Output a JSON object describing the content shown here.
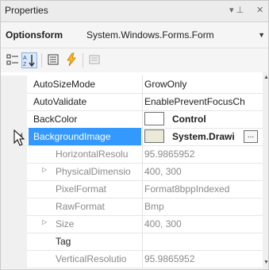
{
  "window": {
    "title": "Properties",
    "pin_glyph": "▾ ⊥",
    "close_glyph": "✕"
  },
  "object_selector": {
    "name": "Optionsform",
    "type": "System.Windows.Forms.Form"
  },
  "toolbar": {
    "buttons": [
      {
        "icon": "categorized-icon"
      },
      {
        "icon": "alphabetical-icon",
        "active": true
      },
      {
        "icon": "properties-icon"
      },
      {
        "icon": "events-icon"
      },
      {
        "icon": "property-pages-icon"
      }
    ]
  },
  "properties": [
    {
      "name": "AutoSizeMode",
      "value": "GrowOnly"
    },
    {
      "name": "AutoValidate",
      "value": "EnablePreventFocusCh"
    },
    {
      "name": "BackColor",
      "value": "Control",
      "swatch": "#ffffff"
    },
    {
      "name": "BackgroundImage",
      "value": "System.Drawi",
      "swatch": "#ece9d8",
      "expander": "◢"
    },
    {
      "name": "HorizontalResolu",
      "value": "95.9865952"
    },
    {
      "name": "PhysicalDimensio",
      "value": "400, 300",
      "expander": "▷"
    },
    {
      "name": "PixelFormat",
      "value": "Format8bppIndexed"
    },
    {
      "name": "RawFormat",
      "value": "Bmp"
    },
    {
      "name": "Size",
      "value": "400, 300",
      "expander": "▷"
    },
    {
      "name": "Tag",
      "value": ""
    },
    {
      "name": "VerticalResolutio",
      "value": "95.9865952"
    }
  ],
  "ellipsis_label": "...",
  "colors": {
    "selection": "#3399ff",
    "active_toolbar": "#dbe9fb",
    "events_icon": "#f5c400"
  }
}
